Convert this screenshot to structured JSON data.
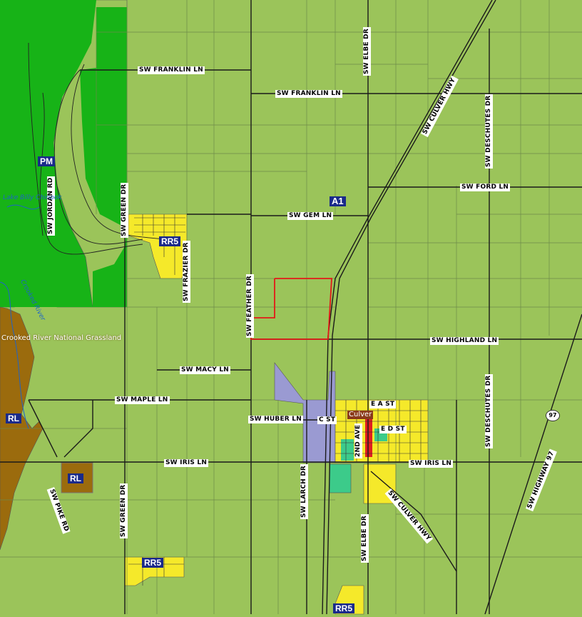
{
  "map": {
    "zones": {
      "pm": "PM",
      "a1": "A1",
      "rl_main": "RL",
      "rl_small": "RL",
      "rr5_north": "RR5",
      "rr5_southwest": "RR5",
      "rr5_south": "RR5"
    },
    "roads": {
      "franklin_west": "SW FRANKLIN LN",
      "franklin_mid": "SW FRANKLIN LN",
      "elbe_north": "SW ELBE DR",
      "culver_hwy_north": "SW CULVER HWY",
      "deschutes_north": "SW DESCHUTES DR",
      "ford": "SW FORD LN",
      "jordan": "SW JORDAN RD",
      "green_north": "SW GREEN DR",
      "gem": "SW GEM LN",
      "frazier": "SW FRAZIER DR",
      "feather": "SW FEATHER DR",
      "highland": "SW HIGHLAND LN",
      "macy": "SW MACY LN",
      "maple": "SW MAPLE LN",
      "huber": "SW HUBER LN",
      "c_st": "C ST",
      "e_a_st": "E A ST",
      "e_d_st": "E D ST",
      "second_ave": "2ND AVE",
      "iris_west": "SW IRIS LN",
      "iris_east": "SW IRIS LN",
      "larch": "SW LARCH DR",
      "elbe_south": "SW ELBE DR",
      "culver_hwy_south": "SW CULVER HWY",
      "deschutes_south": "SW DESCHUTES DR",
      "highway97": "SW HIGHWAY 97",
      "pike": "SW PIKE RD",
      "green_south": "SW GREEN DR"
    },
    "shield_97": "97",
    "town": "Culver",
    "water": {
      "lake_billy_chinook": "Lake Billy Chinook",
      "crooked_river": "Crooked River"
    },
    "grassland": "Crooked River National Grassland",
    "colors": {
      "a1": "#9bc45a",
      "pm": "#17b317",
      "rl": "#9b6b0d",
      "rr5": "#f5e92a",
      "industrial": "#9a9ad2",
      "commercial": "#e02020",
      "public": "#3ccb8a",
      "highlight_parcel": "#e41818"
    }
  }
}
